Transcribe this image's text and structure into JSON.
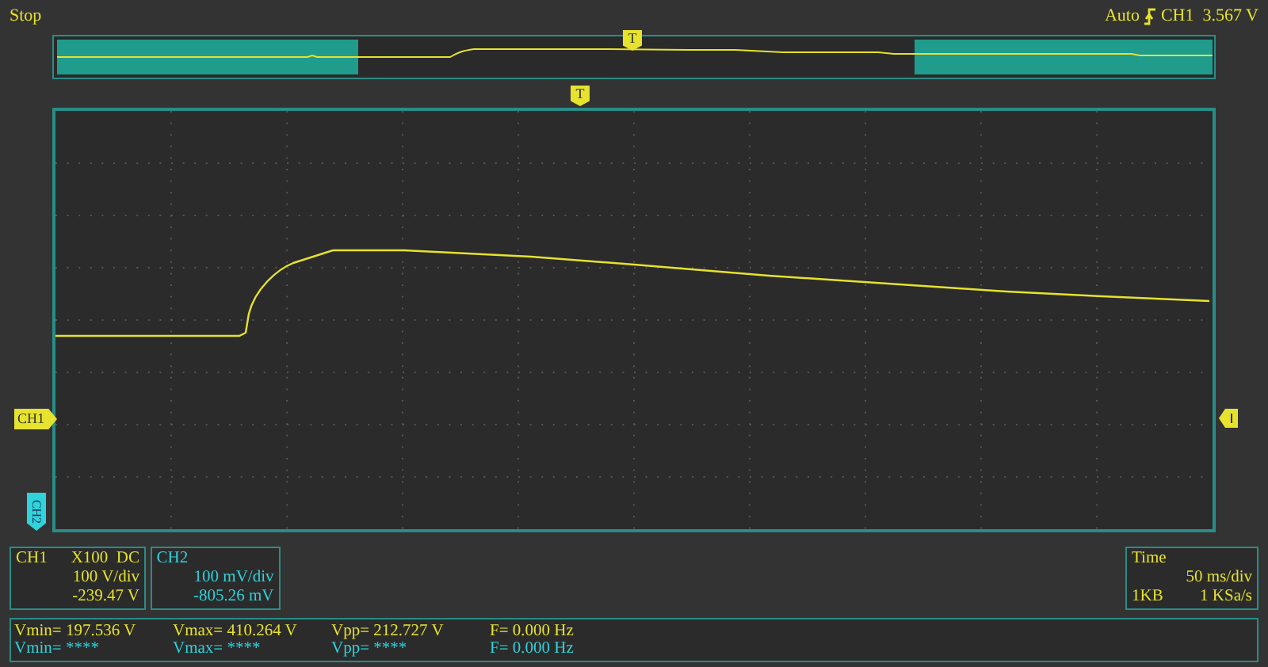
{
  "status": "Stop",
  "trigger": {
    "mode": "Auto",
    "source": "CH1",
    "level": "3.567 V"
  },
  "markers": {
    "trigger_top": "T",
    "trigger_main": "T",
    "ch1": "CH1",
    "ch2": "CH2"
  },
  "channels": [
    {
      "name": "CH1",
      "probe": "X100",
      "coupling": "DC",
      "scale": "100 V/div",
      "offset": "-239.47 V",
      "color": "#e6e22e"
    },
    {
      "name": "CH2",
      "scale": "100 mV/div",
      "offset": "-805.26 mV",
      "color": "#2fd3dc"
    }
  ],
  "timebase": {
    "label": "Time",
    "scale": "50 ms/div",
    "depth": "1KB",
    "rate": "1 KSa/s"
  },
  "measurements": [
    {
      "color": "#e6e22e",
      "values": [
        "Vmin= 197.536 V",
        "Vmax= 410.264 V",
        "Vpp= 212.727 V",
        "F= 0.000 Hz"
      ]
    },
    {
      "color": "#2fd3dc",
      "values": [
        "Vmin= ****",
        "Vmax= ****",
        "Vpp= ****",
        "F= 0.000 Hz"
      ]
    }
  ]
}
